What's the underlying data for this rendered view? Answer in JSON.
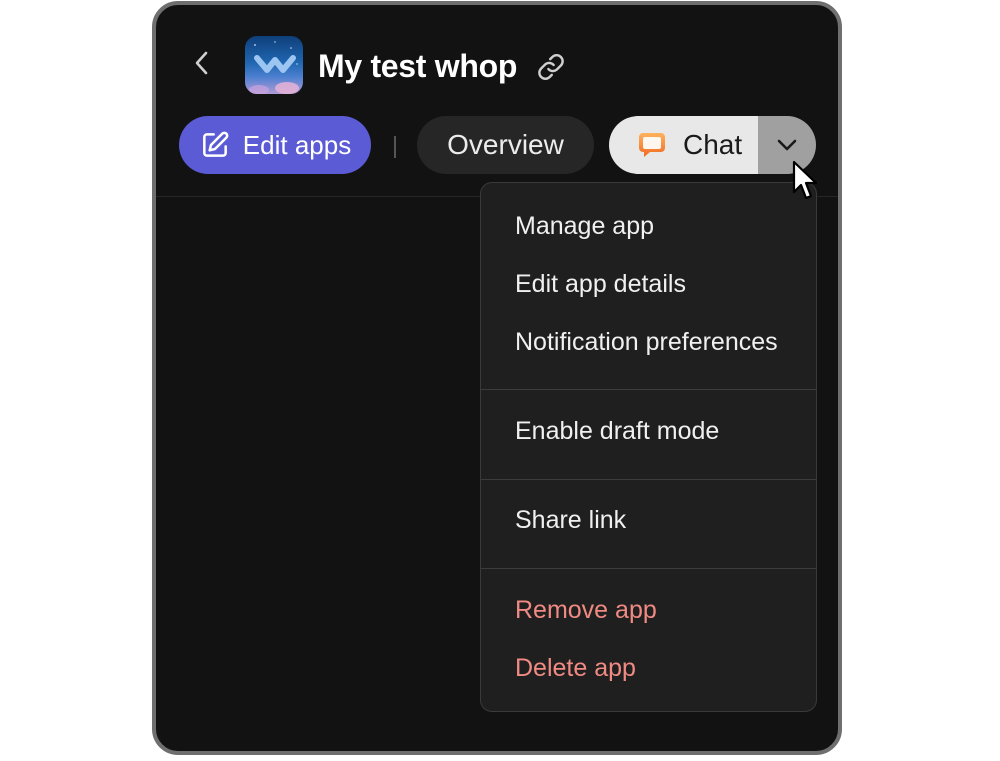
{
  "header": {
    "back_icon": "chevron-left-icon",
    "app_icon": "app-logo-icon",
    "title": "My test whop",
    "link_icon": "link-icon"
  },
  "toolbar": {
    "edit_apps_label": "Edit apps",
    "edit_apps_icon": "edit-pencil-icon",
    "overview_label": "Overview",
    "chat_label": "Chat",
    "chat_icon": "speech-balloon-icon",
    "chat_caret_icon": "chevron-down-icon"
  },
  "menu": {
    "groups": [
      {
        "items": [
          "Manage app",
          "Edit app details",
          "Notification preferences"
        ]
      },
      {
        "items": [
          "Enable draft mode"
        ]
      },
      {
        "items": [
          "Share link"
        ]
      },
      {
        "items": [
          "Remove app",
          "Delete app"
        ],
        "danger": true
      }
    ]
  },
  "colors": {
    "accent": "#5b5bd6",
    "danger": "#f08a82",
    "background": "#121212"
  }
}
